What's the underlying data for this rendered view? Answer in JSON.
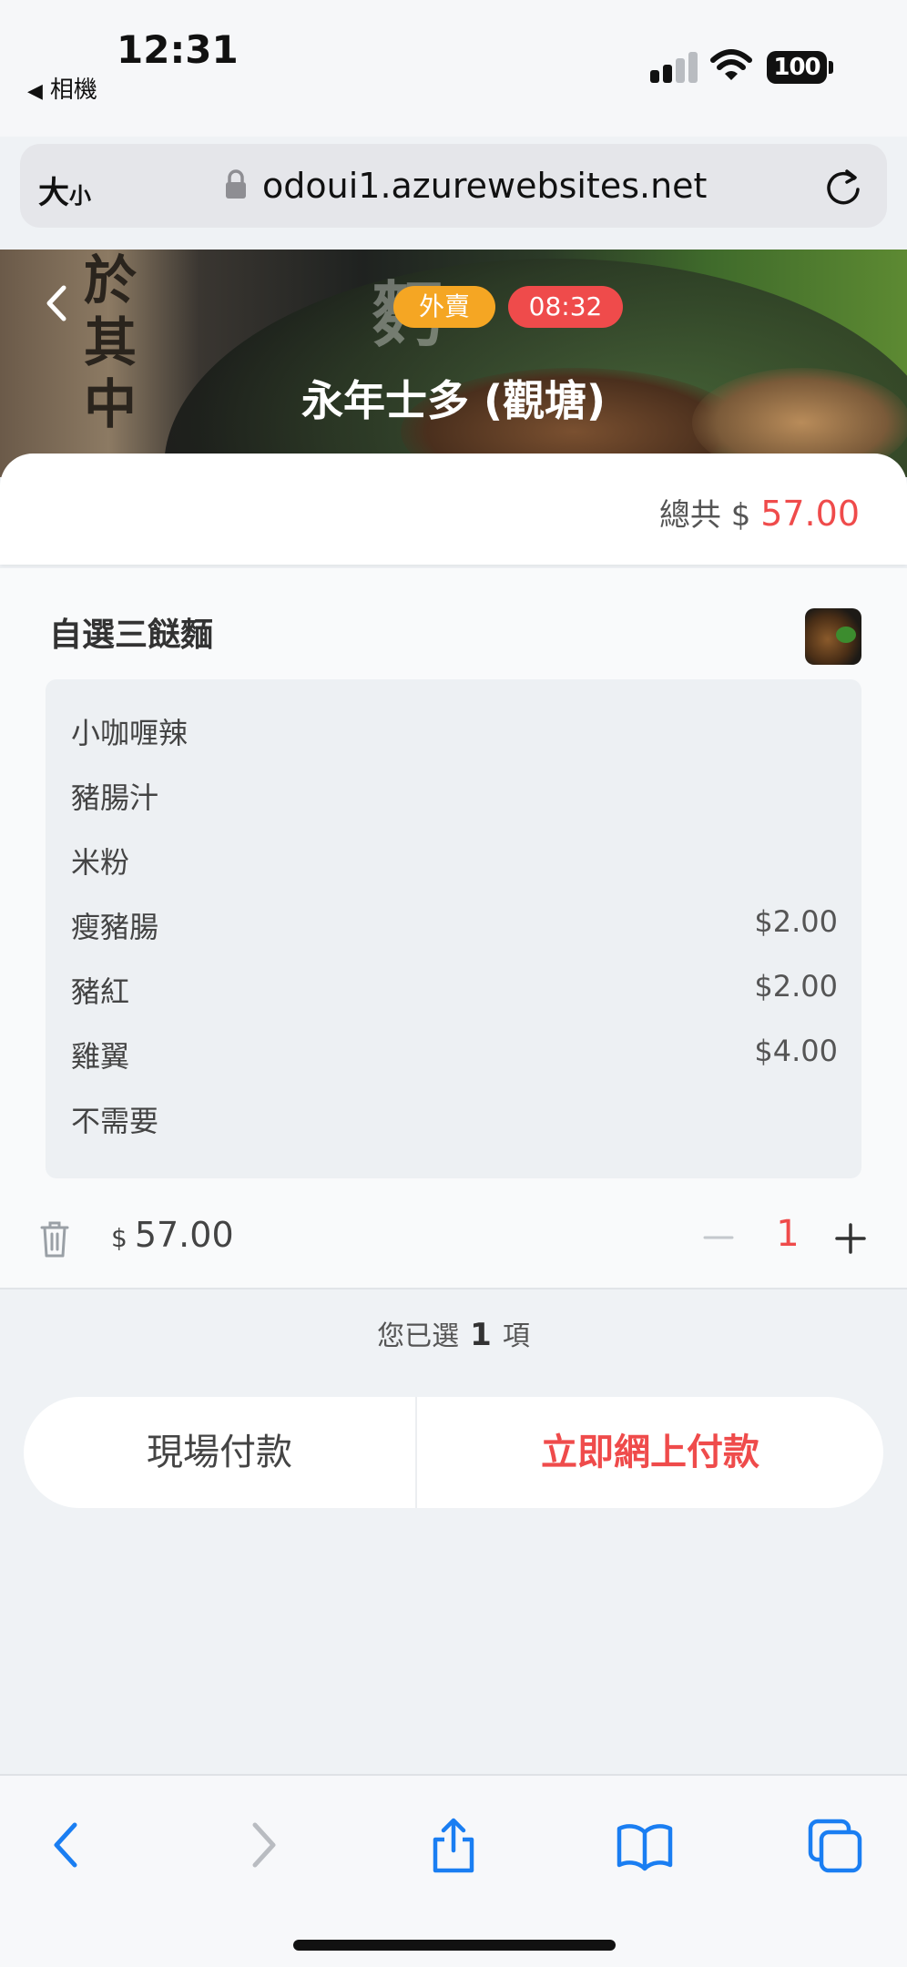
{
  "status_bar": {
    "time": "12:31",
    "back_app": "相機",
    "battery": "100"
  },
  "url_bar": {
    "text_size_label": "大",
    "text_size_small": "小",
    "url": "odoui1.azurewebsites.net"
  },
  "header": {
    "order_type_badge": "外賣",
    "time_badge": "08:32",
    "shop_name": "永年士多 (觀塘)",
    "banner_text_1": "於其中",
    "banner_text_2": "麪"
  },
  "summary": {
    "total_label": "總共 $",
    "total_amount": "57.00"
  },
  "item": {
    "name": "自選三餸麵",
    "options": [
      {
        "label": "小咖喱辣",
        "price": ""
      },
      {
        "label": "豬腸汁",
        "price": ""
      },
      {
        "label": "米粉",
        "price": ""
      },
      {
        "label": "瘦豬腸",
        "price": "$2.00"
      },
      {
        "label": "豬紅",
        "price": "$2.00"
      },
      {
        "label": "雞翼",
        "price": "$4.00"
      },
      {
        "label": "不需要",
        "price": ""
      }
    ],
    "currency": "$",
    "line_price": "57.00",
    "quantity": "1"
  },
  "selection": {
    "prefix": "您已選",
    "count": "1",
    "suffix": "項"
  },
  "actions": {
    "pay_offline": "現場付款",
    "pay_online": "立即網上付款"
  },
  "colors": {
    "accent_red": "#ef4b4b",
    "badge_orange": "#f5a623",
    "safari_blue": "#1a7ef2"
  },
  "toolbar_icons": [
    "back-icon",
    "forward-icon",
    "share-icon",
    "bookmarks-icon",
    "tabs-icon"
  ]
}
